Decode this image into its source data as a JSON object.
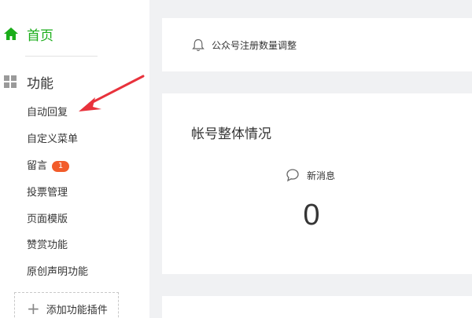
{
  "sidebar": {
    "home_label": "首页",
    "section_label": "功能",
    "items": [
      {
        "label": "自动回复"
      },
      {
        "label": "自定义菜单"
      },
      {
        "label": "留言",
        "badge": "1"
      },
      {
        "label": "投票管理"
      },
      {
        "label": "页面模版"
      },
      {
        "label": "赞赏功能"
      },
      {
        "label": "原创声明功能"
      }
    ],
    "add_plugin_label": "添加功能插件",
    "home_icon": "home-icon",
    "section_icon": "grid-icon",
    "active_color": "#1aad19",
    "badge_color": "#f25c2b"
  },
  "notice": {
    "icon": "bell-icon",
    "text": "公众号注册数量调整"
  },
  "stats": {
    "title": "帐号整体情况",
    "new_messages_icon": "chat-icon",
    "new_messages_label": "新消息",
    "new_messages_count": "0"
  },
  "annotation": {
    "arrow_color": "#e8323c"
  }
}
